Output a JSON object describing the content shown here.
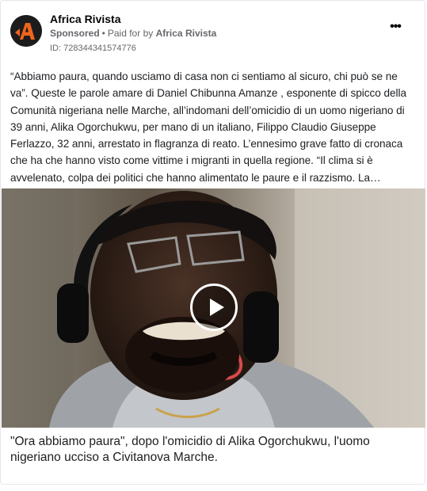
{
  "post": {
    "advertiser_name": "Africa Rivista",
    "sponsored_label": "Sponsored",
    "separator": "•",
    "paid_for_prefix": "Paid for by",
    "paid_for_name": "Africa Rivista",
    "ad_id": "ID: 728344341574776",
    "more_icon": "more-horizontal-icon",
    "body_text": "“Abbiamo paura, quando usciamo di casa non ci sentiamo al sicuro, chi può se ne va”. Queste le parole amare di Daniel Chibunna Amanze , esponente di spicco della Comunità nigeriana nelle Marche, all’indomani dell’omicidio di un uomo nigeriano di 39 anni, Alika Ogorchukwu, per mano di un italiano, Filippo Claudio Giuseppe Ferlazzo, 32 anni, arrestato in flagranza di reato. L’ennesimo grave fatto di cronaca che ha che hanno visto come vittime i migranti in quella regione. “Il clima si è avvelenato, colpa dei politici che hanno alimentato le paure e il razzismo. La…",
    "video": {
      "play_icon": "play-icon"
    },
    "caption": "\"Ora abbiamo paura\", dopo l'omicidio di Alika Ogorchukwu, l'uomo nigeriano ucciso a Civitanova Marche."
  },
  "colors": {
    "logo_orange": "#f0641e",
    "secondary_text": "#65676b",
    "border": "#e4e6eb"
  }
}
